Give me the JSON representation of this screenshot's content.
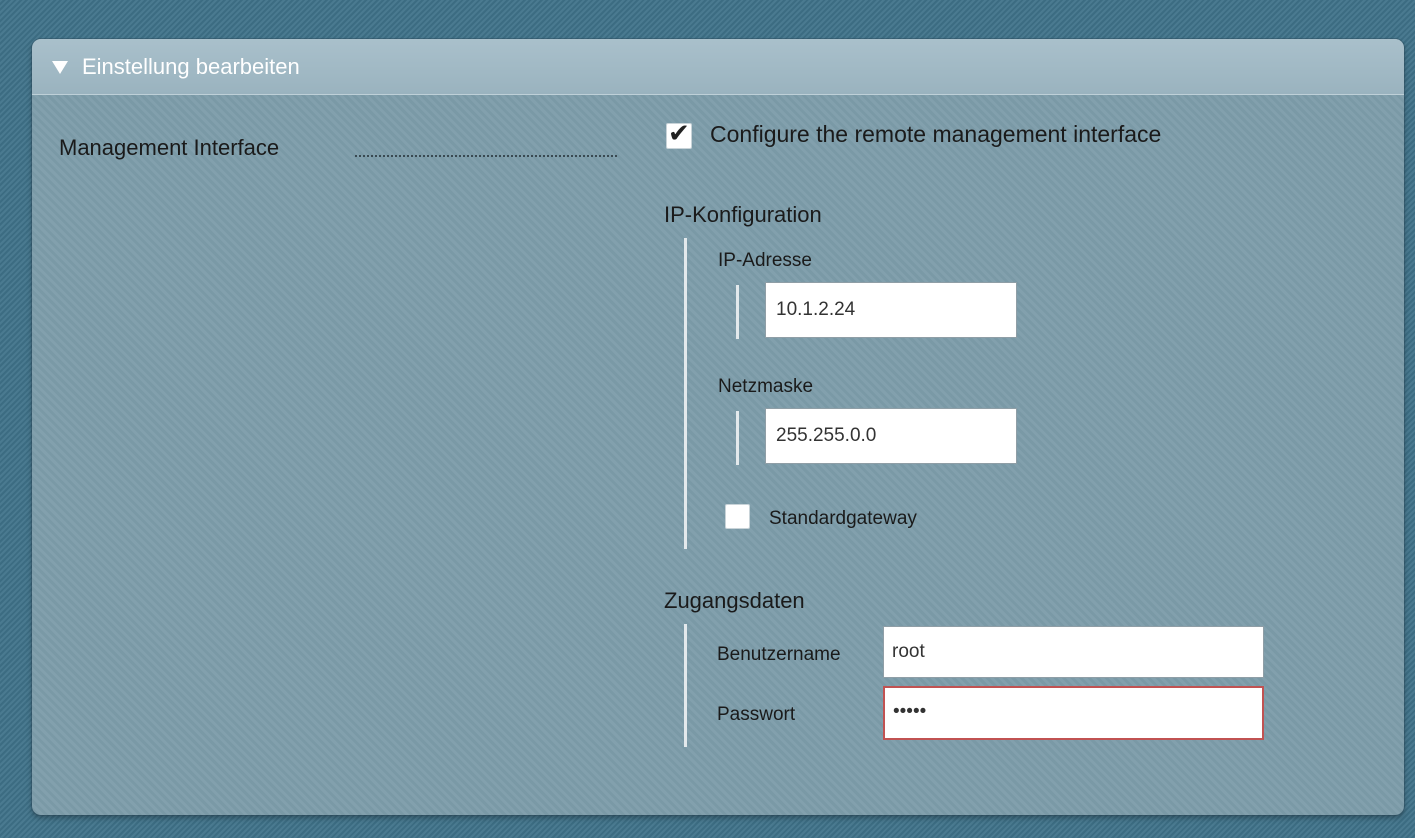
{
  "header": {
    "title": "Einstellung bearbeiten"
  },
  "management": {
    "label": "Management Interface",
    "checkbox_label": "Configure the remote management interface",
    "checked": true
  },
  "ip_config": {
    "title": "IP-Konfiguration",
    "ip_label": "IP-Adresse",
    "ip_value": "10.1.2.24",
    "netmask_label": "Netzmaske",
    "netmask_value": "255.255.0.0",
    "gateway_label": "Standardgateway",
    "gateway_checked": false
  },
  "access": {
    "title": "Zugangsdaten",
    "username_label": "Benutzername",
    "username_value": "root",
    "password_label": "Passwort",
    "password_value": "•••••"
  },
  "icons": {
    "header": "triangle-down-icon",
    "check": "checkmark-icon"
  },
  "colors": {
    "background": "#3f7289",
    "panel": "#7d9daa",
    "header": "#a3bac5",
    "error_border": "#c15252"
  }
}
